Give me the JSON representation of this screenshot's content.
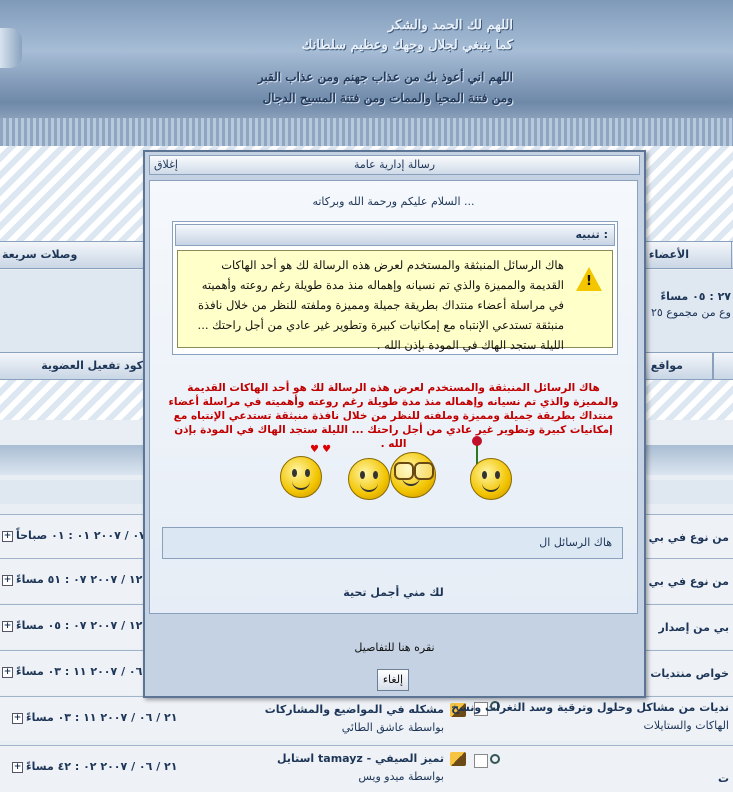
{
  "banner": {
    "line1": "اللهم لك الحمد والشكر",
    "line2": "كما ينبغي لجلال وجهك وعظيم سلطانك",
    "line3": "اللهم اني أعوذ بك من عذاب جهنم  ومن عذاب القبر",
    "line4": "ومن فتنة المحيا والممات ومن فتنة المسيح الدجال"
  },
  "navbar1": {
    "members": "الأعضاء",
    "quick_links": "وصلات سريعة"
  },
  "stats": {
    "time": "٢٧ : ٠٥ مساءً",
    "total": "وع من مجموع ٢٥"
  },
  "navbar2": {
    "sites": "مواقع",
    "activate": "كود تفعيل العضوية"
  },
  "rows": [
    {
      "date": "٠٧ / ٢٠٠٧ ٠١ : ٠١ صباحاً",
      "title": "من نوع في بي"
    },
    {
      "date": "١٢ / ٢٠٠٧ ٠٧ : ٥١ مساءً",
      "title": "من نوع في بي"
    },
    {
      "date": "١٢ / ٢٠٠٧ ٠٧ : ٠٥ مساءً",
      "title": "بي من إصدار"
    },
    {
      "date": "٠٦ / ٢٠٠٧ ١١ : ٠٣ مساءً",
      "title": "خواص منتديات"
    },
    {
      "date": "٢١ / ٠٦ / ٢٠٠٧ ١١ : ٠٣ مساءً",
      "topic_title": "مشكله في المواضيع والمشاركات",
      "topic_by": "بواسطة عاشق الطائي",
      "title": "نديات من مشاكل وحلول وترقية وسد الثغرات ونسخ",
      "sub": "الهاكات والستايلات"
    },
    {
      "date": "٢١ / ٠٦ / ٢٠٠٧ ٠٢ : ٤٢ مساءً",
      "topic_title": "استايل tamayz - تميز الصيفي",
      "topic_by": "بواسطة ميدو ويس",
      "title": "ت"
    }
  ],
  "modal": {
    "title": "رسالة إدارية عامة",
    "close": "إغلاق",
    "greeting": "السلام عليكم ورحمة الله وبركاته ...",
    "notice_title": "تنبيه :",
    "notice_text": "هاك الرسائل المنبثقة والمستخدم لعرض هذه الرسالة لك هو أحد الهاكات القديمة والمميزة والذي تم نسيانه وإهماله منذ مدة طويلة رغم روعته وأهميته في مراسلة أعضاء منتداك بطريقة جميلة ومميزة وملفته للنظر من خلال نافذة منبثقة تستدعي الإنتباه مع إمكانيات كبيرة وتطوير غير عادي من أجل راحتك ... الليلة ستجد الهاك في المودة بإذن الله .",
    "red_text": "هاك الرسائل المنبثقة والمستخدم لعرض هذه الرسالة لك هو أحد الهاكات القديمة والمميزة والذي تم نسيانه وإهماله منذ مدة طويلة رغم روعته وأهميته في مراسلة أعضاء منتداك بطريقة جميلة ومميزة وملفته للنظر من خلال نافذة منبثقة تستدعي الإنتباه مع إمكانيات كبيرة وتطوير غير عادي من أجل راحتك ... الليلة ستجد الهاك في المودة بإذن الله .",
    "chat_text": "هاك الرسائل ال",
    "signature": "لك مني أجمل تحية",
    "details": "نقره هنا للتفاصيل",
    "cancel": "إلغاء"
  }
}
